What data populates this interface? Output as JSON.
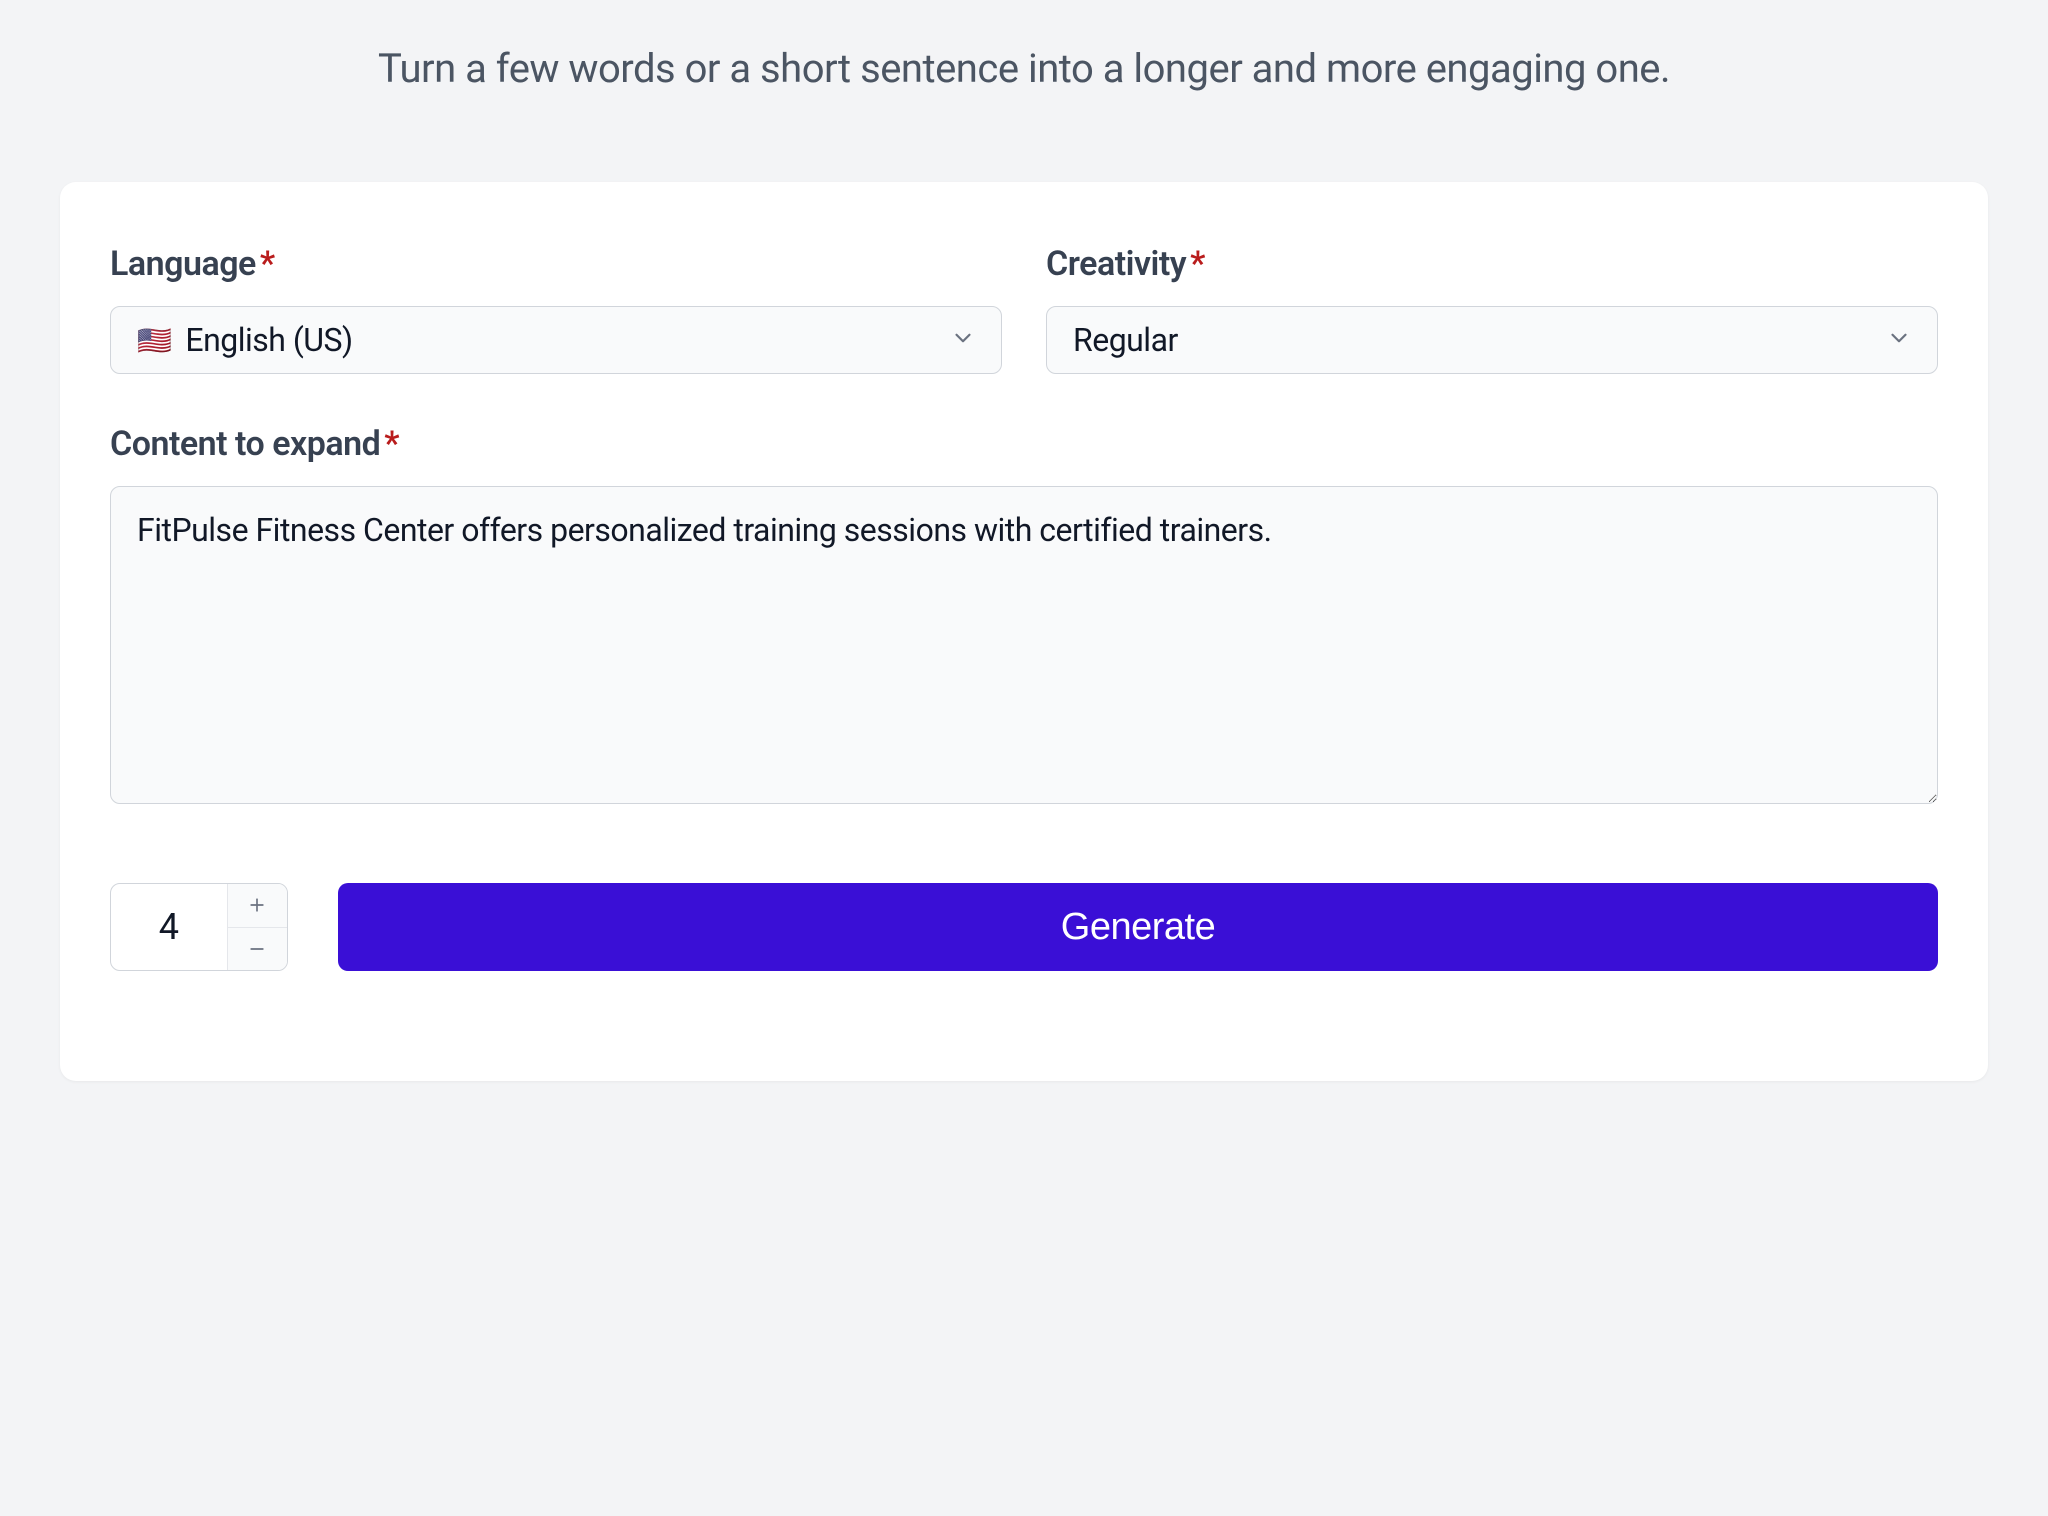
{
  "header": {
    "subtitle": "Turn a few words or a short sentence into a longer and more engaging one."
  },
  "form": {
    "language": {
      "label": "Language",
      "flag": "🇺🇸",
      "value": "English (US)"
    },
    "creativity": {
      "label": "Creativity",
      "value": "Regular"
    },
    "content": {
      "label": "Content to expand",
      "value": "FitPulse Fitness Center offers personalized training sessions with certified trainers."
    },
    "quantity": {
      "value": "4"
    },
    "generate_label": "Generate"
  }
}
